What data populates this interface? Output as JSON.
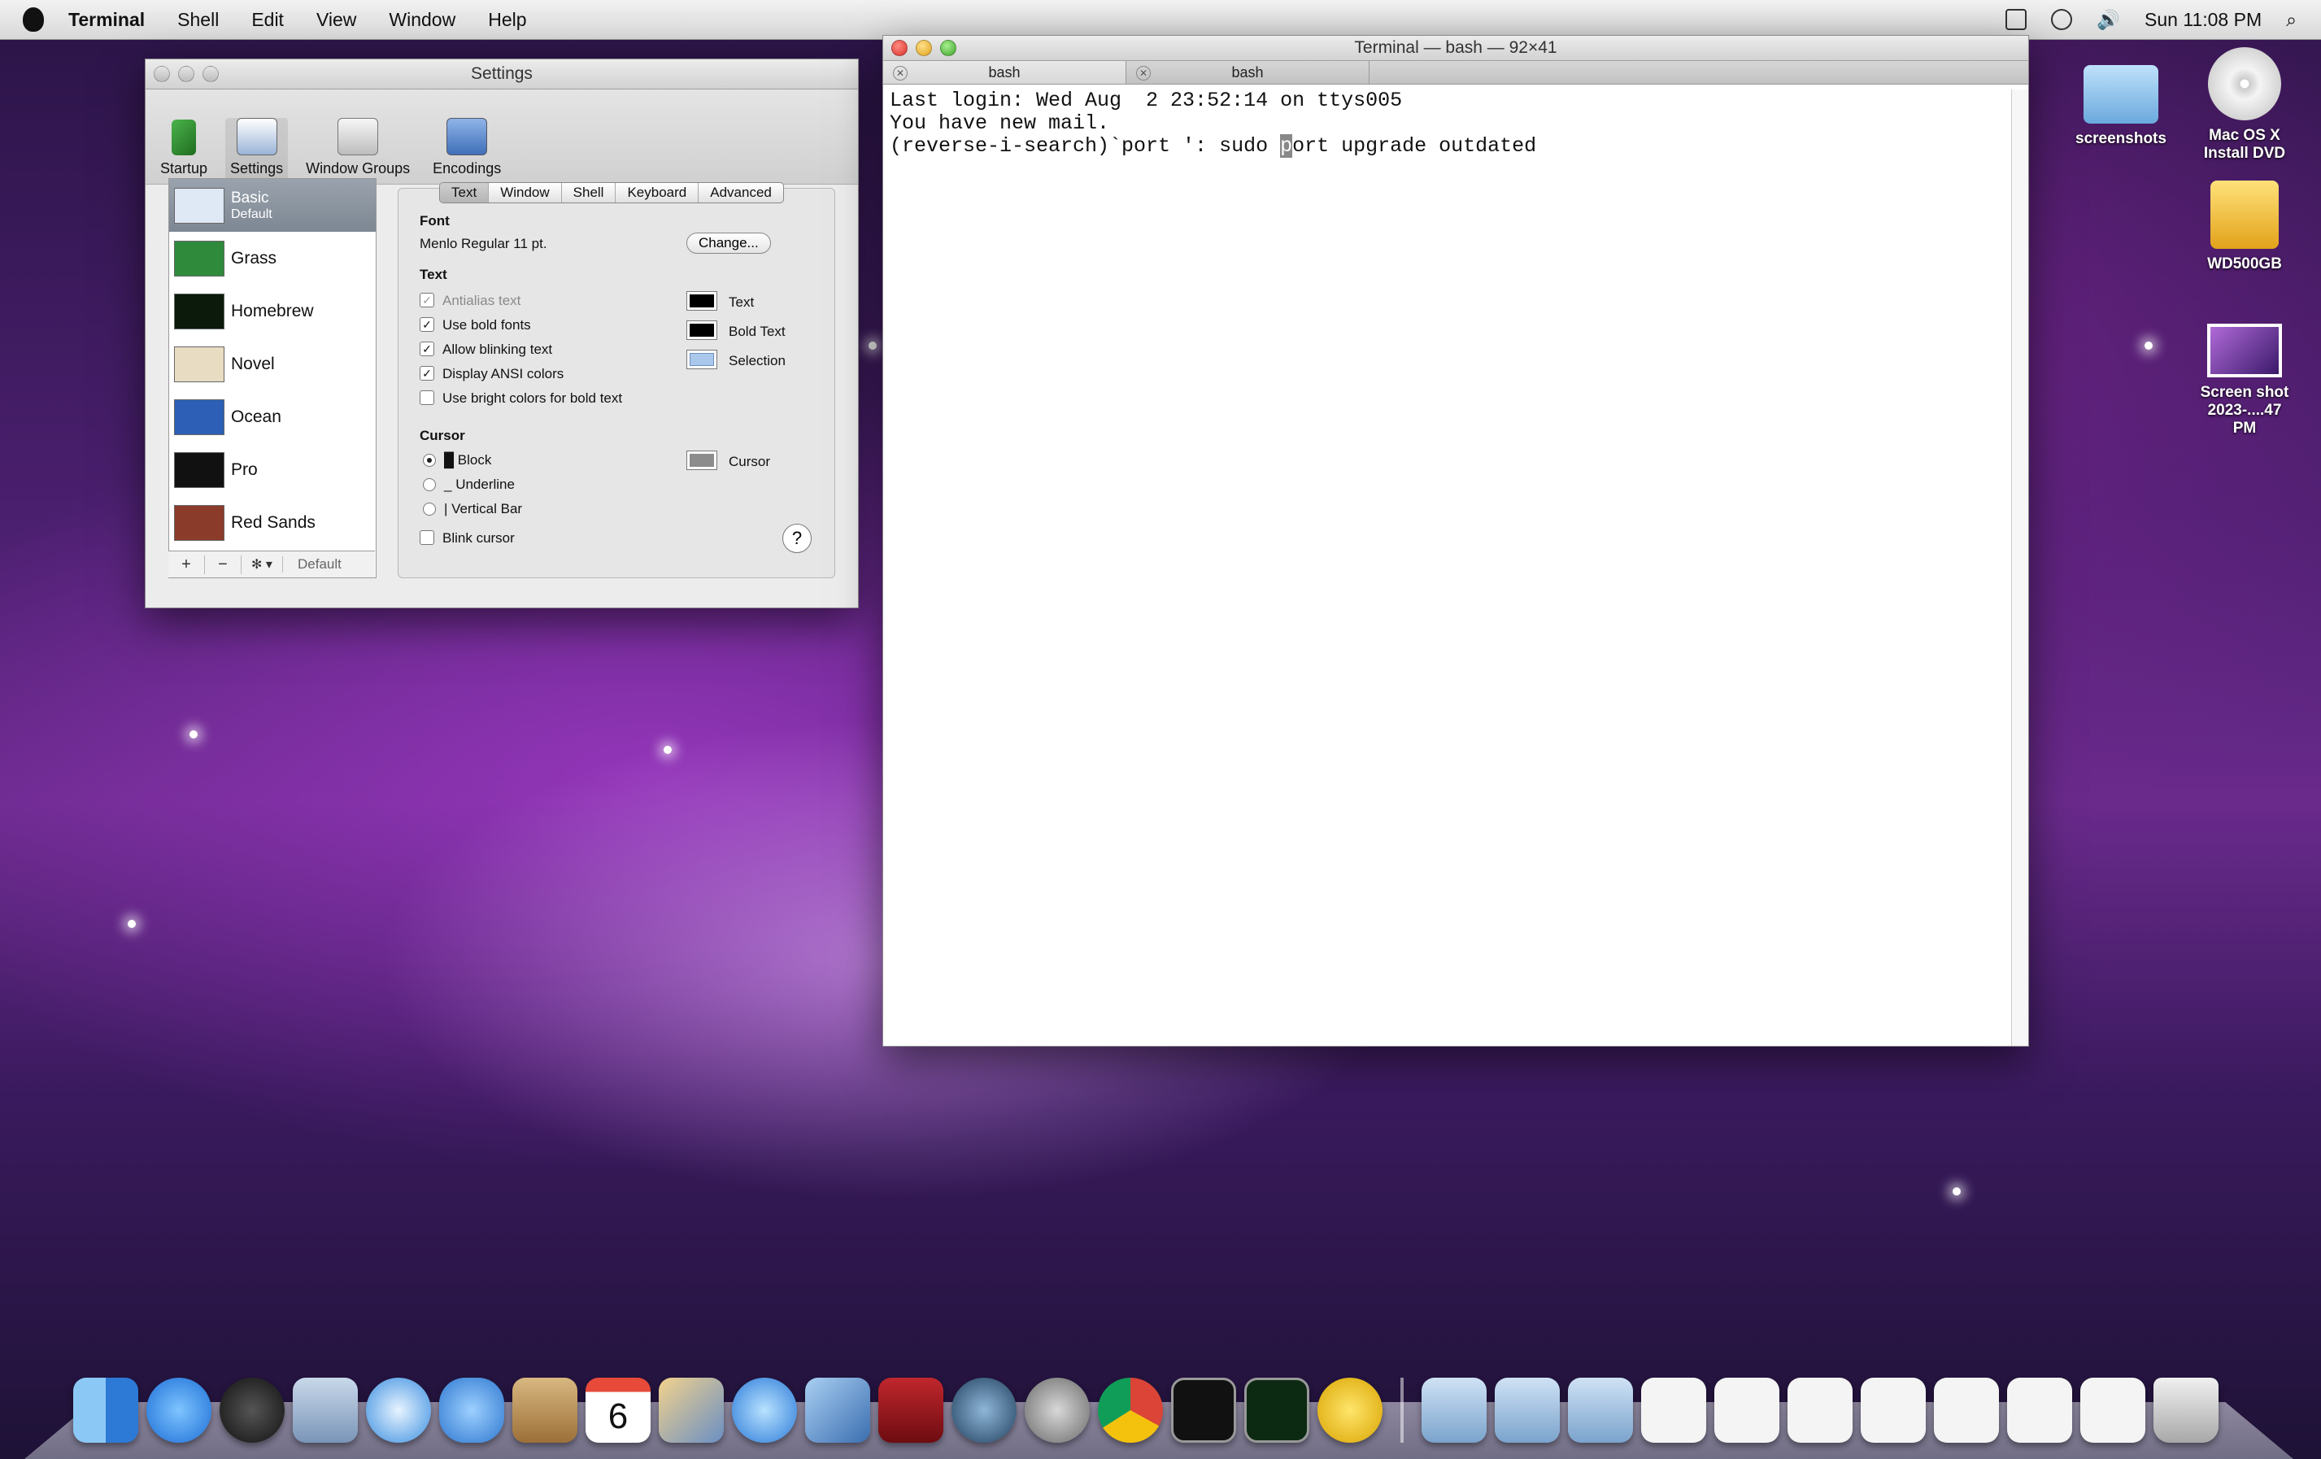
{
  "menubar": {
    "app_name": "Terminal",
    "menus": [
      "Shell",
      "Edit",
      "View",
      "Window",
      "Help"
    ],
    "clock": "Sun 11:08 PM"
  },
  "settings_window": {
    "title": "Settings",
    "toolbar": [
      "Startup",
      "Settings",
      "Window Groups",
      "Encodings"
    ],
    "profiles": [
      {
        "name": "Basic",
        "sub": "Default",
        "thumb": "#dfe8f5"
      },
      {
        "name": "Grass",
        "thumb": "#2f8a3c"
      },
      {
        "name": "Homebrew",
        "thumb": "#0b1a0b"
      },
      {
        "name": "Novel",
        "thumb": "#e8dcc2"
      },
      {
        "name": "Ocean",
        "thumb": "#2c5fb5"
      },
      {
        "name": "Pro",
        "thumb": "#111111"
      },
      {
        "name": "Red Sands",
        "thumb": "#8b3b2a"
      }
    ],
    "profile_bar": {
      "add": "+",
      "remove": "−",
      "gear": "✻ ▾",
      "default": "Default"
    },
    "tabs": [
      "Text",
      "Window",
      "Shell",
      "Keyboard",
      "Advanced"
    ],
    "font_heading": "Font",
    "font_value": "Menlo Regular 11 pt.",
    "change_button": "Change...",
    "text_heading": "Text",
    "checkboxes": [
      {
        "label": "Antialias text",
        "checked": true,
        "disabled": true
      },
      {
        "label": "Use bold fonts",
        "checked": true
      },
      {
        "label": "Allow blinking text",
        "checked": true
      },
      {
        "label": "Display ANSI colors",
        "checked": true
      },
      {
        "label": "Use bright colors for bold text",
        "checked": false
      }
    ],
    "color_swatches": [
      {
        "label": "Text",
        "color": "#000000"
      },
      {
        "label": "Bold Text",
        "color": "#000000"
      },
      {
        "label": "Selection",
        "color": "#a9c8ec"
      }
    ],
    "cursor_heading": "Cursor",
    "cursor_options": [
      "Block",
      "Underline",
      "Vertical Bar"
    ],
    "cursor_color_label": "Cursor",
    "blink_cursor": "Blink cursor",
    "help": "?"
  },
  "terminal_window": {
    "title": "Terminal — bash — 92×41",
    "tabs": [
      "bash",
      "bash"
    ],
    "lines": [
      "Last login: Wed Aug  2 23:52:14 on ttys005",
      "You have new mail."
    ],
    "search_prefix": "(reverse-i-search)`port ': sudo ",
    "search_cursor_char": "p",
    "search_suffix": "ort upgrade outdated"
  },
  "desktop_icons": [
    {
      "label": "screenshots",
      "icon": "folder-icon"
    },
    {
      "label": "Mac OS X Install DVD",
      "icon": "dvd-icon"
    },
    {
      "label": "WD500GB",
      "icon": "usb-drive-icon"
    },
    {
      "label": "Screen shot 2023-....47 PM",
      "icon": "screenshot-file-icon"
    }
  ],
  "calendar_day": "6"
}
